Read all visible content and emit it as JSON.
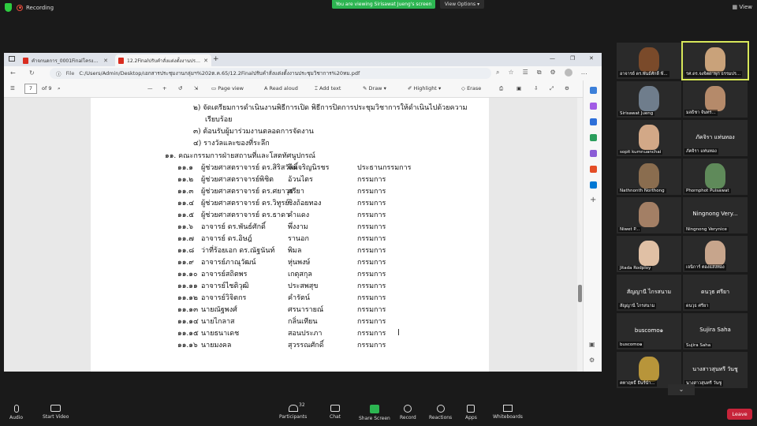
{
  "zoom": {
    "recording_label": "Recording",
    "banner": "You are viewing Sirisawat Jueng's screen",
    "view_options": "View Options",
    "view_label": "View"
  },
  "browser": {
    "tabs": [
      {
        "label": "คำจกนดการ_0001Finalโครงการประชุม"
      },
      {
        "label": "12.2Finalปรับคำสั่งแต่งตั้งงานประชุม/ก"
      }
    ],
    "url_prefix": "File",
    "url": "C:/Users/Admin/Desktop/เอกสารประชุมงานกลุ่มฯ%202ต.ค.65/12.2Finalปรับคำสั่งแต่งตั้งงานประชุมวิชาการ%20ทม.pdf",
    "pdf_toolbar": {
      "page_current": "7",
      "page_total": "of 9",
      "page_view": "Page view",
      "read_aloud": "Read aloud",
      "add_text": "Add text",
      "draw": "Draw",
      "highlight": "Highlight",
      "erase": "Erase"
    }
  },
  "document": {
    "lines_top": [
      "๒) จัดเตรียมการดำเนินงานพิธีการเปิด พิธีการปิดการประชุมวิชาการให้ดำเนินไปด้วยความ",
      "เรียบร้อย",
      "๓) ต้อนรับผู้มาร่วมงานตลอดการจัดงาน",
      "๔) รางวัลและของที่ระลึก"
    ],
    "section_heading": "๑๑. คณะกรรมการฝ่ายสถานที่และโสตทัศนูปกรณ์",
    "members": [
      {
        "no": "๑๑.๑",
        "name": "ผู้ช่วยศาสตราจารย์ ดร.สิริสวัสดิ์",
        "surname": "จึงเจริญนิรชร",
        "role": "ประธานกรรมการ"
      },
      {
        "no": "๑๑.๒",
        "name": "ผู้ช่วยศาสตราจารย์พิชิต",
        "surname": "อ้วนไตร",
        "role": "กรรมการ"
      },
      {
        "no": "๑๑.๓",
        "name": "ผู้ช่วยศาสตราจารย์ ดร.ศยาวุธ",
        "surname": "ศรียา",
        "role": "กรรมการ"
      },
      {
        "no": "๑๑.๔",
        "name": "ผู้ช่วยศาสตราจารย์ ดร.วิทูรย์",
        "surname": "ชิงถ้อยทอง",
        "role": "กรรมการ"
      },
      {
        "no": "๑๑.๕",
        "name": "ผู้ช่วยศาสตราจารย์ ดร.ธาดา",
        "surname": "คำแดง",
        "role": "กรรมการ"
      },
      {
        "no": "๑๑.๖",
        "name": "อาจารย์ ดร.พันธ์ศักดิ์",
        "surname": "พึ่งงาม",
        "role": "กรรมการ"
      },
      {
        "no": "๑๑.๗",
        "name": "อาจารย์ ดร.อิษฎ์",
        "surname": "รานอก",
        "role": "กรรมการ"
      },
      {
        "no": "๑๑.๘",
        "name": "ว่าที่ร้อยเอก ดร.ณัฐนันท์",
        "surname": "พิมล",
        "role": "กรรมการ"
      },
      {
        "no": "๑๑.๙",
        "name": "อาจารย์ภาณุวัฒน์",
        "surname": "หุ่นพงษ์",
        "role": "กรรมการ"
      },
      {
        "no": "๑๑.๑๐",
        "name": "อาจารย์สถิตพร",
        "surname": "เกตุสกุล",
        "role": "กรรมการ"
      },
      {
        "no": "๑๑.๑๑",
        "name": "อาจารย์ไชติวุฒิ",
        "surname": "ประสพสุข",
        "role": "กรรมการ"
      },
      {
        "no": "๑๑.๑๒",
        "name": "อาจารย์วิจิตกร",
        "surname": "คำรัตน์",
        "role": "กรรมการ"
      },
      {
        "no": "๑๑.๑๓",
        "name": "นายณัฐพงศ์",
        "surname": "ศรนารายณ์",
        "role": "กรรมการ"
      },
      {
        "no": "๑๑.๑๔",
        "name": "นายไกลาส",
        "surname": "กลิ่นเทียน",
        "role": "กรรมการ"
      },
      {
        "no": "๑๑.๑๕",
        "name": "นายธนาเดช",
        "surname": "สอนประภา",
        "role": "กรรมการ"
      },
      {
        "no": "๑๑.๑๖",
        "name": "นายมงคล",
        "surname": "สุวรรณศักดิ์",
        "role": "กรรมการ"
      }
    ]
  },
  "participants": [
    {
      "name": "อาจารย์ ดร.พันธ์ศักดิ์ พึ่..."
    },
    {
      "name": "รศ.ดร.จงจิตดาพุก ธรรมปร..."
    },
    {
      "name": "Sirisawat Jueng"
    },
    {
      "name": "มลธิชา จันทร..."
    },
    {
      "name": "sopit kumnuanchai"
    },
    {
      "name": "ภัคจิรา แท่นทอง",
      "center": "ภัคจิรา แท่นทอง"
    },
    {
      "name": "Nathnonth Northong"
    },
    {
      "name": "Phornphot Puisawat"
    },
    {
      "name": "Niwet P..."
    },
    {
      "name": "Ningnong Verynice",
      "center": "Ningnong Very..."
    },
    {
      "name": "Jitada Rodploy"
    },
    {
      "name": "เจนิการ์ ตองแสงทอง"
    },
    {
      "name": "สัญญานี ไกรสนาม",
      "center": "สัญญานี ไกรสนาม"
    },
    {
      "name": "ดนวุธ ศรียา",
      "center": "ดนวุธ ศรียา"
    },
    {
      "name": "buscomo๑",
      "center": "buscomo๑"
    },
    {
      "name": "Sujira Saha",
      "center": "Sujira Saha"
    },
    {
      "name": "คทาฤทธิ์ ธีนร์นำ..."
    },
    {
      "name": "นางสาวสุนทรี วันชู",
      "center": "นางสาวสุนทรี วันชู"
    }
  ],
  "toolbar": {
    "audio": "Audio",
    "start_video": "Start Video",
    "participants": "Participants",
    "participants_count": "32",
    "chat": "Chat",
    "share_screen": "Share Screen",
    "record": "Record",
    "reactions": "Reactions",
    "apps": "Apps",
    "whiteboards": "Whiteboards",
    "leave": "Leave"
  }
}
